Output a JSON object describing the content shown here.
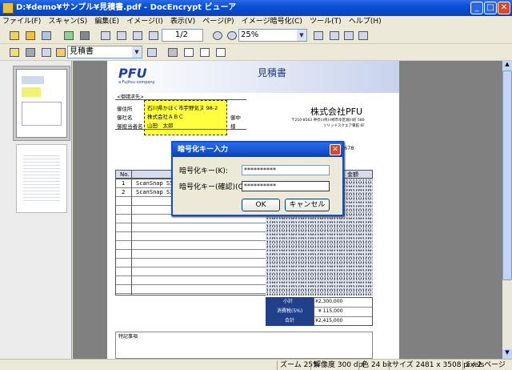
{
  "window": {
    "title": "D:¥demo¥サンプル¥見積書.pdf - DocEncrypt ビューア",
    "minimize": "_",
    "maximize": "□",
    "close": "✕"
  },
  "menu": [
    "ファイル(F)",
    "スキャン(S)",
    "編集(E)",
    "イメージ(I)",
    "表示(V)",
    "ページ(P)",
    "イメージ暗号化(C)",
    "ツール(T)",
    "ヘルプ(H)"
  ],
  "toolbar": {
    "page_field": "1/2",
    "zoom_value": "25%",
    "doctype_value": "見積書"
  },
  "document": {
    "logo": "PFU",
    "logo_sub": "a Fujitsu company",
    "title": "見積書",
    "dest_label": "<御請求先>",
    "address_label": "御住所",
    "company_label": "御社名",
    "person_label": "御担当者名",
    "address_value": "石川県かほく市宇野気ヌ 98-2",
    "company_value": "株式会社ＡＢＣ",
    "person_value": "山田　太郎",
    "onchu": "御中",
    "sama": "様",
    "issuer": "株式会社PFU",
    "issuer_address": "〒210-8563 神奈川県川崎市幸区堀川町 580",
    "issuer_building": "ソリッドスクエア東館 6F",
    "issuer_partial": "678",
    "table_header_no": "No.",
    "table_header_amount": "金額",
    "rows": [
      {
        "no": "1",
        "item": "ScanSnap S510"
      },
      {
        "no": "2",
        "item": "ScanSnap S310"
      }
    ],
    "subtotal_label": "小計",
    "subtotal_value": "¥2,300,000",
    "tax_label": "消費税(5%)",
    "tax_value": "¥ 115,000",
    "total_label": "合計",
    "total_value": "¥2,415,000",
    "notes_label": "特記事項"
  },
  "dialog": {
    "title": "暗号化キー入力",
    "key_label": "暗号化キー(K):",
    "key_value": "**********",
    "confirm_label": "暗号化キー(確認)(C):",
    "confirm_value": "**********",
    "ok": "OK",
    "cancel": "キャンセル"
  },
  "status": {
    "zoom": "ズーム 25%",
    "resolution": "解像度 300 dpi",
    "color": "色 24 bit",
    "size": "サイズ 2481 x 3508 pixels",
    "page": "1 / 2 ページ"
  }
}
